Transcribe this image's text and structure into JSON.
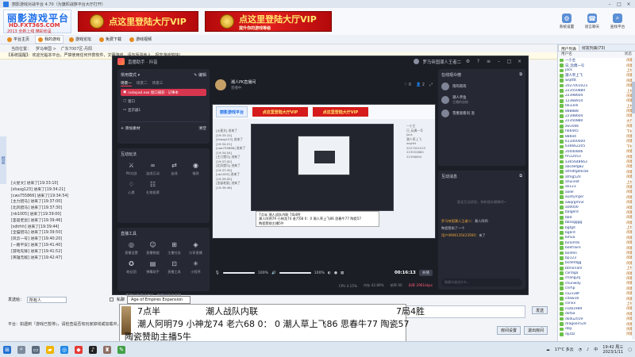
{
  "bg_app": {
    "title": "丽影游戏对战平台 4.70（为旗帜战族平台大厅打开）",
    "brand": {
      "line1": "丽影游戏平台",
      "line2": "HD.FXT365.COM",
      "line3": "2013 全新上线 精彩纷呈"
    },
    "vip_banner_text": "点这里登陆大厅VIP",
    "vip_banner_sub": "提升你的游戏等级",
    "top_tools": [
      "系统设置",
      "语言聊天",
      "查找平台"
    ],
    "nav": [
      "平台主页",
      "我的游戏",
      "游戏论坛",
      "免费下载",
      "游戏视频"
    ],
    "address": [
      "当前位置：",
      "罗马帝国 >",
      "广东7007区·丹阳"
    ],
    "notice": "【系统提醒】：欢迎光临本平台，严禁使用任何作弊软件，文明游戏，请勿辱骂他人，祝您游戏愉快！",
    "left_tab": "频道",
    "chat_log": [
      "[火星文] 进来了[19:33:10]",
      "[shasg123] 进来了[19:34:21]",
      "[cws755866] 进来了[19:34:54]",
      "[主力猎马] 进来了[19:37:00]",
      "[北风猎马] 进来了[19:37:30]",
      "[nb1005] 进来了[19:39:00]",
      "[圣诞老鼠] 进来了[19:39:46]",
      "[sdtrhh] 进来了[19:39:44]",
      "[全猫猎马] 进来了[19:39:50]",
      "[风云一号] 进来了[19:40:20]",
      "[一路平安] 进来了[19:41:40]",
      "[游戏先锋] 进来了[19:41:52]",
      "[英雄无敌] 进来了[19:42:47]"
    ],
    "input_label": "发送给：",
    "input_select": "所有人",
    "private_label": "私聊",
    "send_label": "发送",
    "status_tip": "平台：如遇到『游戏已暂停』，请检查是否有玩家掉线或加载中，请耐心等待游戏恢复。",
    "bottom_buttons": [
      "房间设置",
      "退出房间"
    ],
    "right_tabs": [
      "用户列表",
      "好友列表(73)"
    ],
    "right_head": [
      "用户名",
      "状态"
    ],
    "users": [
      {
        "name": "一小主",
        "status": "闲着"
      },
      {
        "name": "日_玩偶一号",
        "status": "闲着"
      },
      {
        "name": "jack",
        "status": "上线"
      },
      {
        "name": "潮人草上飞",
        "status": "闲着"
      },
      {
        "name": "wsjtttt",
        "status": "闲着"
      },
      {
        "name": "2027001023",
        "status": "闲着"
      },
      {
        "name": "223550880",
        "status": "上线"
      },
      {
        "name": "22398604",
        "status": "闲着"
      },
      {
        "name": "12368914",
        "status": "闲着"
      },
      {
        "name": "6633s6",
        "status": "上线"
      },
      {
        "name": "888888",
        "status": "闲着"
      },
      {
        "name": "22398604",
        "status": "闲着"
      },
      {
        "name": "22350880",
        "status": "大厅"
      },
      {
        "name": "zw1006",
        "status": "闲着"
      },
      {
        "name": "h66445",
        "status": "下线"
      },
      {
        "name": "88604",
        "status": "闲着"
      },
      {
        "name": "611000000",
        "status": "闲着"
      },
      {
        "name": "636662205",
        "status": "下线"
      },
      {
        "name": "20040806",
        "status": "闲着"
      },
      {
        "name": "fm12053",
        "status": "闲着"
      },
      {
        "name": "a365648663",
        "status": "闲着"
      },
      {
        "name": "abcdefg82",
        "status": "闲着"
      },
      {
        "name": "afmdfgdds58",
        "status": "闲着"
      },
      {
        "name": "afmg520",
        "status": "闲着"
      },
      {
        "name": "ahuiinet",
        "status": "上线"
      },
      {
        "name": "ak123",
        "status": "闲着"
      },
      {
        "name": "aoler",
        "status": "闲着"
      },
      {
        "name": "auntyrrger",
        "status": "闲着"
      },
      {
        "name": "awqrgrhne",
        "status": "闲着"
      },
      {
        "name": "a00000",
        "status": "闲着"
      },
      {
        "name": "balgerd",
        "status": "闲着"
      },
      {
        "name": "bbd",
        "status": "闲着"
      },
      {
        "name": "bbssgggg",
        "status": "闲着"
      },
      {
        "name": "bgfgd",
        "status": "上线"
      },
      {
        "name": "bgkrd",
        "status": "闲着"
      },
      {
        "name": "bihua",
        "status": "闲着"
      },
      {
        "name": "biranfdn",
        "status": "闲着"
      },
      {
        "name": "bokfraire",
        "status": "闲着"
      },
      {
        "name": "bolifen",
        "status": "闲着"
      },
      {
        "name": "bp123",
        "status": "闲着"
      },
      {
        "name": "bsdefdgg",
        "status": "闲着"
      },
      {
        "name": "btmoriam",
        "status": "上线"
      },
      {
        "name": "cardiga",
        "status": "闲着"
      },
      {
        "name": "chang2q",
        "status": "闲着"
      },
      {
        "name": "chunwdy",
        "status": "闲着"
      },
      {
        "name": "cnrhp",
        "status": "闲着"
      },
      {
        "name": "ca2338f",
        "status": "闲着"
      },
      {
        "name": "cdaw18",
        "status": "闲着"
      },
      {
        "name": "conxx",
        "status": "上线"
      },
      {
        "name": "cxzb1989",
        "status": "闲着"
      },
      {
        "name": "dofaa",
        "status": "闲着"
      },
      {
        "name": "dodu2019",
        "status": "闲着"
      },
      {
        "name": "dragoon520",
        "status": "闲着"
      },
      {
        "name": "dzg",
        "status": "闲着"
      },
      {
        "name": "dyzzz",
        "status": "闲着"
      }
    ]
  },
  "stream_app": {
    "title": "直播助手 · 抖音",
    "user_title": "罗马帝国潮人王者二",
    "scene_panel": {
      "title": "常用模式 ▾",
      "action": "✎ 编辑",
      "tabs": [
        "场景一",
        "场景二",
        "场景三"
      ],
      "sources": [
        "notepad.exe 窗口捕获 · 记事本",
        "窗口",
        "显示器1"
      ],
      "add_label": "+ 添加素材",
      "clear_label": "清空"
    },
    "interact_panel": {
      "title": "互动玩法",
      "tools": [
        "PK对战",
        "连线互动",
        "连线",
        "福袋",
        "心愿",
        "礼物投票"
      ]
    },
    "live_panel": {
      "title": "直播工具",
      "tools": [
        "直播设置",
        "直播数据",
        "主播任务",
        "分享直播",
        "粉丝团",
        "弹幕助手",
        "直播工具",
        "小程序"
      ]
    },
    "foot_hint": "不建议直播间挂机 · 直播间违规说明",
    "anchor": {
      "name": "潮人PK直播间",
      "status": "直播中"
    },
    "head_icons": [
      "♡ 0",
      "👤 2"
    ],
    "preview_overlay": [
      "7点半 潮人战队内联 7局4胜",
      "潮人阿明79 小神龙74 老六68 0：0 潮人草上飞86 思春牛77 陶瓷57",
      "陶瓷赞助主播5牛"
    ],
    "mic_value": "100%",
    "speaker_value": "100%",
    "mic_level": 1.0,
    "speaker_level": 1.0,
    "timer": "00:16:13",
    "stop_label": "关播",
    "stats": {
      "cpu": "CPU 4.15%",
      "memory": "内存 42.89%",
      "frame": "帧率 60",
      "bitrate": "码率 2961kbps"
    },
    "audience_panel": {
      "title": "在线观众榜",
      "rows": [
        {
          "name": "雨筠雨筠",
          "sub": ""
        },
        {
          "name": "潮人草鱼",
          "sub": "主播的忠粉"
        },
        {
          "name": "雪墨观看同 温",
          "sub": ""
        }
      ]
    },
    "msg_panel": {
      "title": "互动消息",
      "hint": "暂无互动消息，快和观众聊聊吧~",
      "lines": [
        {
          "head": "罗马帝国潮人王者二：",
          "text": "潮人阿明"
        },
        {
          "head": "",
          "text": "陶瓷赞助了一个"
        },
        {
          "head": "用户4906135423560：",
          "text": "来了"
        }
      ],
      "input_placeholder": "和观众说点什么..."
    }
  },
  "tooltip": "Age of Empires Expansion",
  "scoreboard": {
    "line1_a": "7点半",
    "line1_b": "潮人战队内联",
    "line1_c": "7局4胜",
    "line2": "潮人阿明79 小神龙74 老六68 0： 0 潮人草上飞86 思春牛77 陶瓷57",
    "line3": "陶瓷赞助主播5牛"
  },
  "taskbar": {
    "temp": "17°C 多云",
    "lang": "中",
    "time": "19:42 周三",
    "date": "2023/1/11"
  }
}
